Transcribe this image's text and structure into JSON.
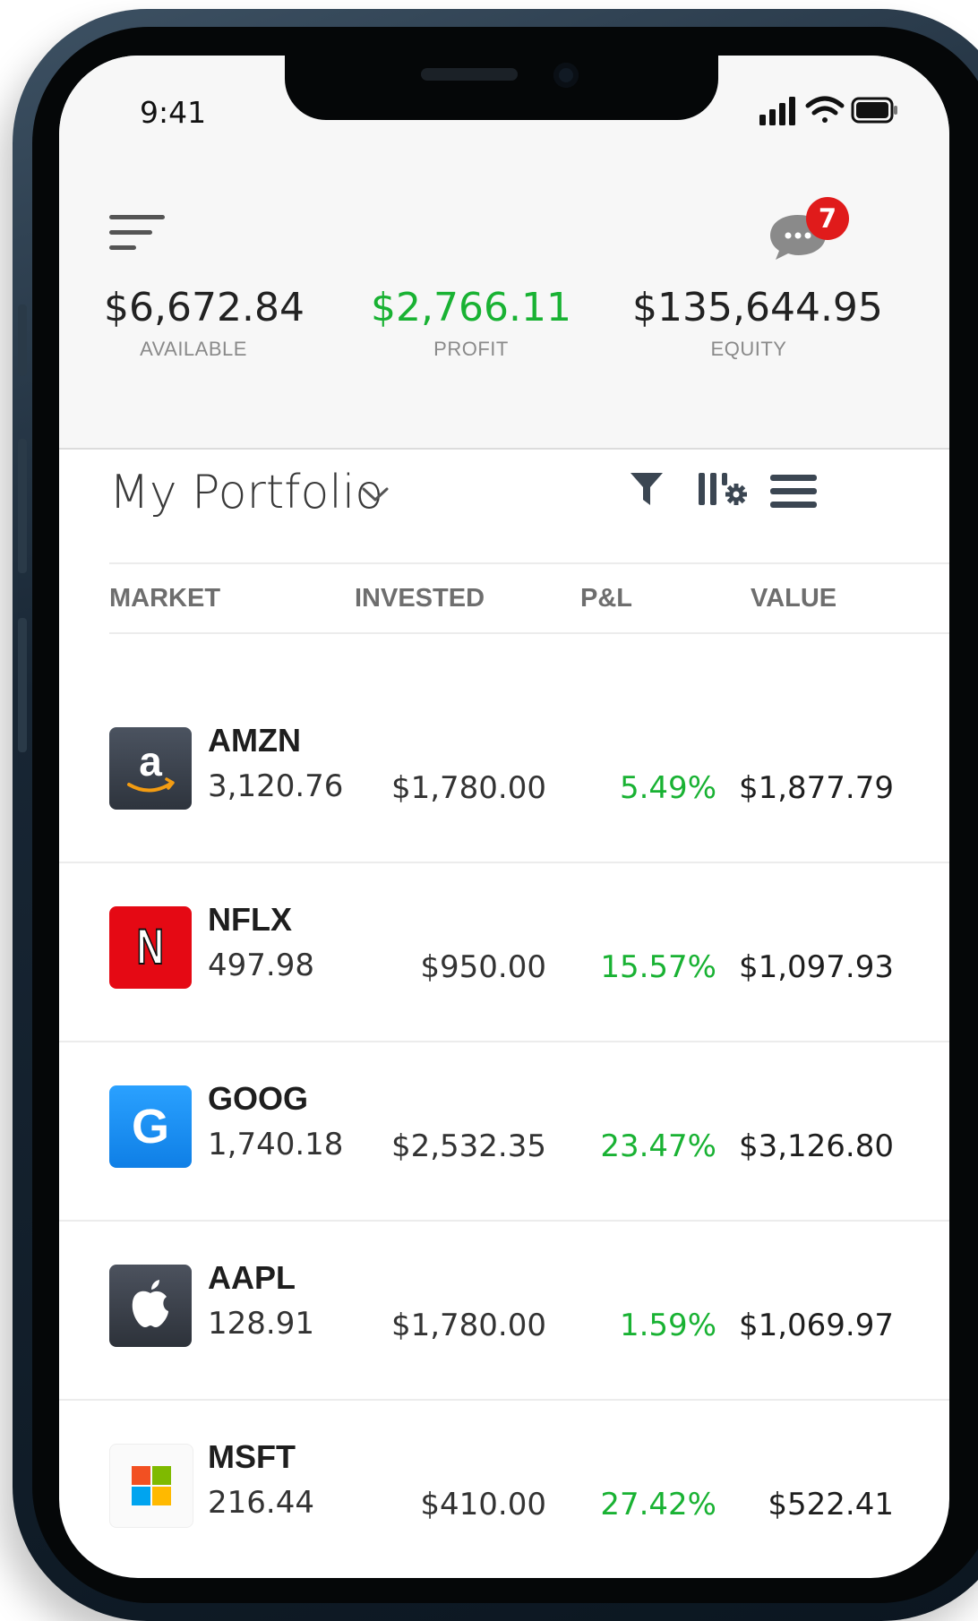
{
  "status_bar": {
    "time": "9:41"
  },
  "header": {
    "notification_count": "7",
    "stats": [
      {
        "value": "$6,672.84",
        "label": "AVAILABLE"
      },
      {
        "value": "$2,766.11",
        "label": "PROFIT"
      },
      {
        "value": "$135,644.95",
        "label": "EQUITY"
      }
    ]
  },
  "portfolio": {
    "title": "My Portfolio",
    "columns": {
      "market": "MARKET",
      "invested": "INVESTED",
      "pl": "P&L",
      "value": "VALUE"
    },
    "rows": [
      {
        "ticker": "AMZN",
        "price": "3,120.76",
        "invested": "$1,780.00",
        "pl": "5.49%",
        "value": "$1,877.79",
        "logo": "amazon-logo",
        "logo_text": "a"
      },
      {
        "ticker": "NFLX",
        "price": "497.98",
        "invested": "$950.00",
        "pl": "15.57%",
        "value": "$1,097.93",
        "logo": "netflix-logo",
        "logo_text": "N"
      },
      {
        "ticker": "GOOG",
        "price": "1,740.18",
        "invested": "$2,532.35",
        "pl": "23.47%",
        "value": "$3,126.80",
        "logo": "google-logo",
        "logo_text": "G"
      },
      {
        "ticker": "AAPL",
        "price": "128.91",
        "invested": "$1,780.00",
        "pl": "1.59%",
        "value": "$1,069.97",
        "logo": "apple-logo"
      },
      {
        "ticker": "MSFT",
        "price": "216.44",
        "invested": "$410.00",
        "pl": "27.42%",
        "value": "$522.41",
        "logo": "microsoft-logo"
      }
    ]
  },
  "colors": {
    "positive": "#19b233",
    "badge": "#e01b1b",
    "amazon": "#3d4550",
    "netflix": "#e50914",
    "google": "#1c8ef2",
    "apple": "#3f4450"
  }
}
